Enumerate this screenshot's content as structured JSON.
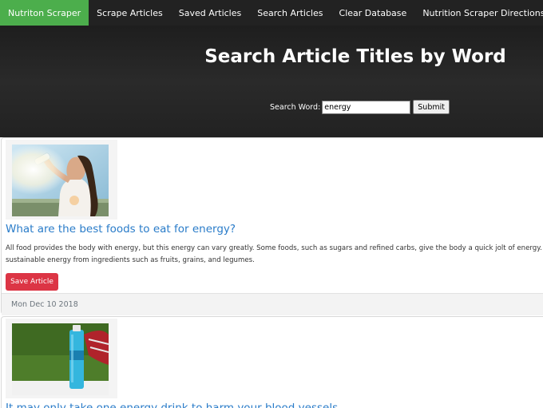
{
  "nav": {
    "brand": "Nutriton Scraper",
    "items": [
      "Scrape Articles",
      "Saved Articles",
      "Search Articles",
      "Clear Database",
      "Nutrition Scraper Directions"
    ]
  },
  "hero": {
    "title": "Search Article Titles by Word",
    "search_label": "Search Word:",
    "search_value": "energy",
    "submit_label": "Submit"
  },
  "articles": [
    {
      "title": "What are the best foods to eat for energy?",
      "summary_line1": "All food provides the body with energy, but this energy can vary greatly. Some foods, such as sugars and refined carbs, give the body a quick jolt of energy. Ho",
      "summary_line2": "sustainable energy from ingredients such as fruits, grains, and legumes.",
      "save_label": "Save Article",
      "date": "Mon Dec 10 2018",
      "image_icon": "woman-drinking-water-photo"
    },
    {
      "title": "It may only take one energy drink to harm your blood vessels",
      "image_icon": "energy-drink-bottle-photo"
    }
  ],
  "colors": {
    "navbar_bg": "#222222",
    "brand_bg": "#4cae4c",
    "link": "#2a7cc9",
    "save_button": "#dc3545"
  }
}
